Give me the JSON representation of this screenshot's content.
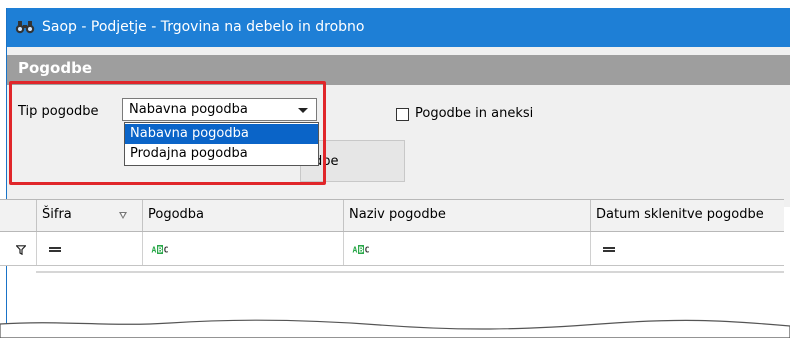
{
  "window": {
    "title": "Saop  - Podjetje - Trgovina na debelo in drobno",
    "app_icon": "binoculars-icon"
  },
  "form": {
    "header": "Pogodbe"
  },
  "filter": {
    "tip_label": "Tip pogodbe",
    "combo_value": "Nabavna pogodba",
    "options": [
      "Nabavna pogodba",
      "Prodajna pogodba"
    ],
    "selected_index": 0,
    "button_text_visible": "dbe",
    "checkbox_label": "Pogodbe in aneksi",
    "checkbox_checked": false
  },
  "grid": {
    "columns": [
      "Šifra",
      "Pogodba",
      "Naziv pogodbe",
      "Datum sklenitve pogodbe"
    ],
    "filter_icons": [
      "filter-icon",
      "equals-icon",
      "abc-icon",
      "abc-icon",
      "equals-icon"
    ]
  },
  "colors": {
    "titlebar": "#1e7fd6",
    "form_header": "#9e9e9e",
    "highlight": "#e0262a",
    "selection": "#0a64c8"
  }
}
